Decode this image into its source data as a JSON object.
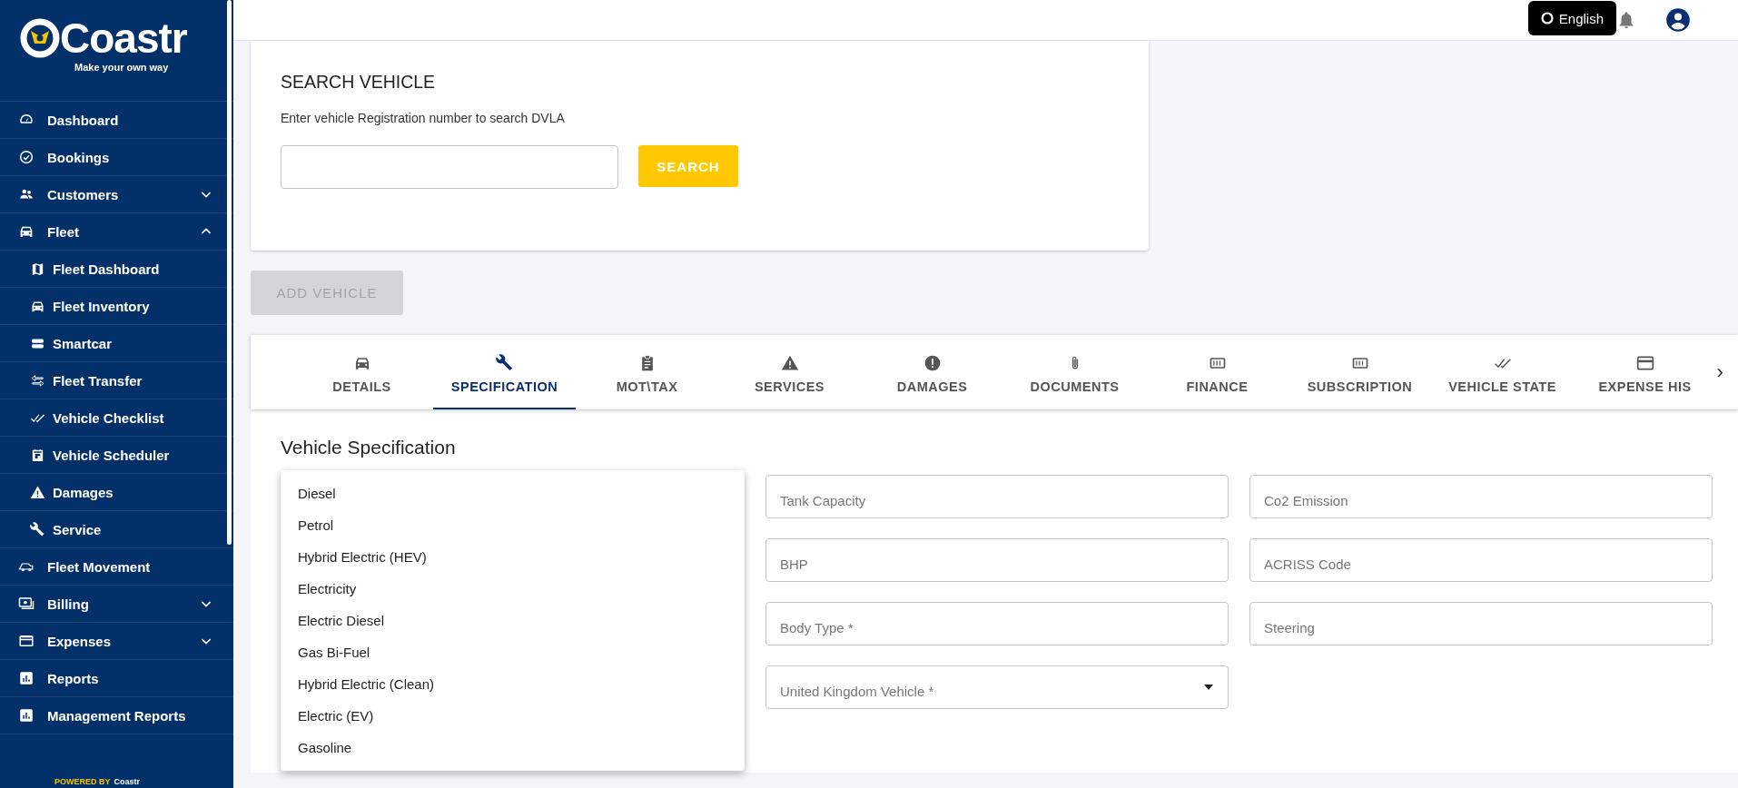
{
  "sidebar": {
    "logo": {
      "name": "Coastr",
      "tagline": "Make your own way"
    },
    "items": [
      {
        "label": "Dashboard"
      },
      {
        "label": "Bookings"
      },
      {
        "label": "Customers",
        "expanded": false
      },
      {
        "label": "Fleet",
        "expanded": true,
        "children": [
          {
            "label": "Fleet Dashboard"
          },
          {
            "label": "Fleet Inventory"
          },
          {
            "label": "Smartcar"
          },
          {
            "label": "Fleet Transfer"
          },
          {
            "label": "Vehicle Checklist"
          },
          {
            "label": "Vehicle Scheduler"
          },
          {
            "label": "Damages"
          },
          {
            "label": "Service"
          }
        ]
      },
      {
        "label": "Fleet Movement"
      },
      {
        "label": "Billing",
        "expanded": false
      },
      {
        "label": "Expenses",
        "expanded": false
      },
      {
        "label": "Reports"
      },
      {
        "label": "Management Reports"
      }
    ],
    "powered_by": {
      "label": "POWERED BY",
      "brand": "Coastr"
    }
  },
  "header": {
    "language": "English"
  },
  "search": {
    "title": "SEARCH VEHICLE",
    "hint": "Enter vehicle Registration number to search DVLA",
    "button": "SEARCH"
  },
  "add_vehicle": {
    "label": "ADD VEHICLE",
    "disabled": true
  },
  "tabs": [
    {
      "label": "DETAILS",
      "selected": false
    },
    {
      "label": "SPECIFICATION",
      "selected": true
    },
    {
      "label": "MOT\\TAX",
      "selected": false
    },
    {
      "label": "SERVICES",
      "selected": false
    },
    {
      "label": "DAMAGES",
      "selected": false
    },
    {
      "label": "DOCUMENTS",
      "selected": false
    },
    {
      "label": "FINANCE",
      "selected": false
    },
    {
      "label": "SUBSCRIPTION",
      "selected": false
    },
    {
      "label": "VEHICLE STATE",
      "selected": false
    },
    {
      "label": "EXPENSE HIS",
      "selected": false
    }
  ],
  "tabs_more": "›",
  "section_title": "Vehicle Specification",
  "fields": [
    {
      "placeholder": "Tank Capacity",
      "kind": "text"
    },
    {
      "placeholder": "Co2 Emission",
      "kind": "text"
    },
    {
      "placeholder": "BHP",
      "kind": "text"
    },
    {
      "placeholder": "ACRISS Code",
      "kind": "text"
    },
    {
      "placeholder": "Body Type *",
      "kind": "text"
    },
    {
      "placeholder": "Steering",
      "kind": "text"
    },
    {
      "placeholder": "United Kingdom Vehicle *",
      "kind": "select"
    }
  ],
  "dropdown": {
    "options": [
      "Diesel",
      "Petrol",
      "Hybrid Electric (HEV)",
      "Electricity",
      "Electric Diesel",
      "Gas Bi-Fuel",
      "Hybrid Electric (Clean)",
      "Electric (EV)",
      "Gasoline"
    ]
  }
}
